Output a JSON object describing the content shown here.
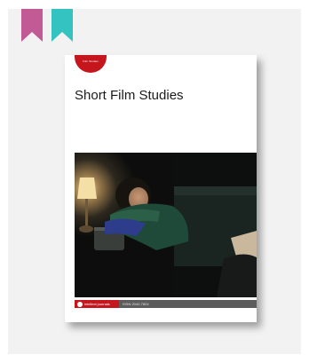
{
  "colors": {
    "bookmark_pink": "#c25a96",
    "bookmark_teal": "#35c3c1",
    "card_background": "#f2f2f2",
    "badge_red": "#c4161c"
  },
  "icons": [
    "bookmark-pink-icon",
    "bookmark-teal-icon",
    "intellect-logo-icon"
  ],
  "cover": {
    "badge_text": "Film Studies",
    "title": "Short Film Studies",
    "footer": {
      "publisher": "intellect journals",
      "issn": "ISSN 2042-7824"
    }
  }
}
